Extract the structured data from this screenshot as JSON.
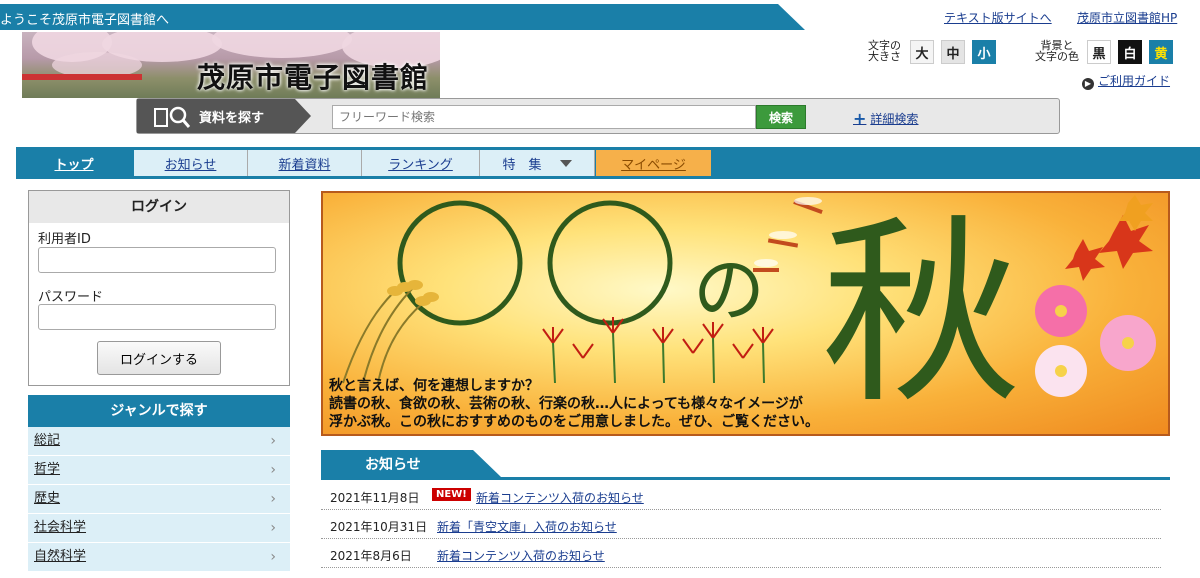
{
  "header": {
    "welcome": "ようこそ茂原市電子図書館へ",
    "links": [
      "テキスト版サイトへ",
      "茂原市立図書館HP"
    ],
    "logo_text": "茂原市電子図書館",
    "font_size_label_1": "文字の",
    "font_size_label_2": "大きさ",
    "font_sizes": [
      "大",
      "中",
      "小"
    ],
    "color_label_1": "背景と",
    "color_label_2": "文字の色",
    "colors": [
      "黒",
      "白",
      "黄"
    ],
    "guide": "ご利用ガイド"
  },
  "search": {
    "tab_label": "資料を探す",
    "placeholder": "フリーワード検索",
    "button": "検索",
    "advanced": "詳細検索"
  },
  "nav": {
    "items": [
      "トップ",
      "お知らせ",
      "新着資料",
      "ランキング",
      "特　集",
      "マイページ"
    ]
  },
  "login": {
    "title": "ログイン",
    "user_id_label": "利用者ID",
    "password_label": "パスワード",
    "button": "ログインする"
  },
  "genre": {
    "title": "ジャンルで探す",
    "items": [
      "総記",
      "哲学",
      "歴史",
      "社会科学",
      "自然科学"
    ]
  },
  "hero": {
    "title_circles": "〇〇の",
    "title_kanji": "秋",
    "lines": [
      "秋と言えば、何を連想しますか？",
      "読書の秋、食欲の秋、芸術の秋、行楽の秋…人によっても様々なイメージが",
      "浮かぶ秋。この秋におすすめのものをご用意しました。ぜひ、ご覧ください。"
    ]
  },
  "notices": {
    "title": "お知らせ",
    "new_badge": "NEW!",
    "items": [
      {
        "date": "2021年11月8日",
        "title": "新着コンテンツ入荷のお知らせ"
      },
      {
        "date": "2021年10月31日",
        "title": "新着「青空文庫」入荷のお知らせ"
      },
      {
        "date": "2021年8月6日",
        "title": "新着コンテンツ入荷のお知らせ"
      }
    ]
  },
  "colors": {
    "brand_blue": "#1a7fa8",
    "light_blue": "#dceff7",
    "mypage_orange": "#f6b04a",
    "search_green": "#3c9a3c"
  }
}
